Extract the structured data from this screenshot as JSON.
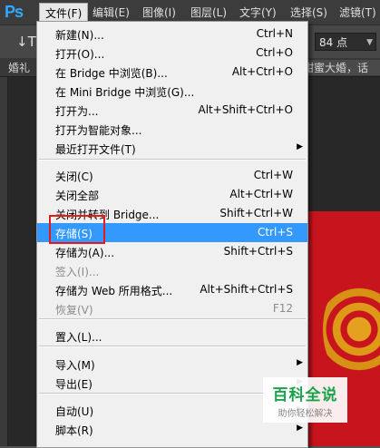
{
  "app": {
    "logo": "Ps"
  },
  "menubar": [
    {
      "label": "文件(F)",
      "active": true
    },
    {
      "label": "编辑(E)"
    },
    {
      "label": "图像(I)"
    },
    {
      "label": "图层(L)"
    },
    {
      "label": "文字(Y)"
    },
    {
      "label": "选择(S)"
    },
    {
      "label": "滤镜(T)"
    }
  ],
  "options_bar": {
    "text_tool_icon": "↓T",
    "font_size": "84 点",
    "dropdown_icon": "chevron-down-icon"
  },
  "document_tabs": {
    "left_fragment": "婚礼",
    "right_fragment": "甜蜜大婚，话"
  },
  "file_menu": {
    "items": [
      {
        "type": "item",
        "label": "新建(N)...",
        "shortcut": "Ctrl+N"
      },
      {
        "type": "item",
        "label": "打开(O)...",
        "shortcut": "Ctrl+O"
      },
      {
        "type": "item",
        "label": "在 Bridge 中浏览(B)...",
        "shortcut": "Alt+Ctrl+O"
      },
      {
        "type": "item",
        "label": "在 Mini Bridge 中浏览(G)...",
        "shortcut": ""
      },
      {
        "type": "item",
        "label": "打开为...",
        "shortcut": "Alt+Shift+Ctrl+O"
      },
      {
        "type": "item",
        "label": "打开为智能对象...",
        "shortcut": ""
      },
      {
        "type": "item",
        "label": "最近打开文件(T)",
        "shortcut": "",
        "submenu": true
      },
      {
        "type": "separator"
      },
      {
        "type": "item",
        "label": "关闭(C)",
        "shortcut": "Ctrl+W"
      },
      {
        "type": "item",
        "label": "关闭全部",
        "shortcut": "Alt+Ctrl+W"
      },
      {
        "type": "item",
        "label": "关闭并转到 Bridge...",
        "shortcut": "Shift+Ctrl+W"
      },
      {
        "type": "item",
        "label": "存储(S)",
        "shortcut": "Ctrl+S",
        "highlighted": true
      },
      {
        "type": "item",
        "label": "存储为(A)...",
        "shortcut": "Shift+Ctrl+S"
      },
      {
        "type": "item",
        "label": "签入(I)...",
        "shortcut": "",
        "disabled": true
      },
      {
        "type": "item",
        "label": "存储为 Web 所用格式...",
        "shortcut": "Alt+Shift+Ctrl+S"
      },
      {
        "type": "item",
        "label": "恢复(V)",
        "shortcut": "F12",
        "disabled": true
      },
      {
        "type": "separator"
      },
      {
        "type": "item",
        "label": "置入(L)...",
        "shortcut": ""
      },
      {
        "type": "separator"
      },
      {
        "type": "item",
        "label": "导入(M)",
        "shortcut": "",
        "submenu": true
      },
      {
        "type": "item",
        "label": "导出(E)",
        "shortcut": "",
        "submenu": true
      },
      {
        "type": "separator"
      },
      {
        "type": "item",
        "label": "自动(U)",
        "shortcut": "",
        "submenu": true
      },
      {
        "type": "item",
        "label": "脚本(R)",
        "shortcut": "",
        "submenu": true
      }
    ]
  },
  "watermark": {
    "title": "百科全说",
    "subtitle": "助你轻松解决"
  },
  "colors": {
    "menu_highlight": "#3399ff",
    "annotation_box": "#e21b1b",
    "canvas_red": "#c8141d",
    "brand_green": "#1aa34a"
  }
}
